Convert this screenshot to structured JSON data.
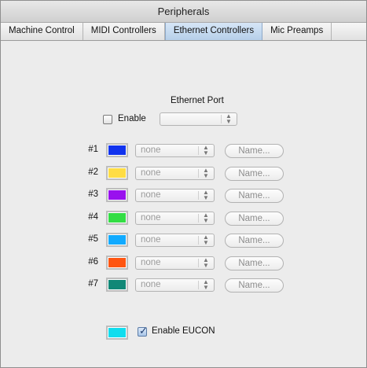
{
  "window": {
    "title": "Peripherals"
  },
  "tabs": [
    {
      "label": "Machine Control",
      "active": false
    },
    {
      "label": "MIDI Controllers",
      "active": false
    },
    {
      "label": "Ethernet Controllers",
      "active": true
    },
    {
      "label": "Mic Preamps",
      "active": false
    }
  ],
  "ethernet": {
    "section_label": "Ethernet Port",
    "enable_label": "Enable",
    "enable_checked": false,
    "port_value": ""
  },
  "controllers": [
    {
      "number": "#1",
      "color": "#1133ee",
      "select_value": "none",
      "name_button": "Name..."
    },
    {
      "number": "#2",
      "color": "#ffdd44",
      "select_value": "none",
      "name_button": "Name..."
    },
    {
      "number": "#3",
      "color": "#9911ee",
      "select_value": "none",
      "name_button": "Name..."
    },
    {
      "number": "#4",
      "color": "#33dd44",
      "select_value": "none",
      "name_button": "Name..."
    },
    {
      "number": "#5",
      "color": "#11aaff",
      "select_value": "none",
      "name_button": "Name..."
    },
    {
      "number": "#6",
      "color": "#ff5511",
      "select_value": "none",
      "name_button": "Name..."
    },
    {
      "number": "#7",
      "color": "#118877",
      "select_value": "none",
      "name_button": "Name..."
    }
  ],
  "eucon": {
    "color": "#11ddee",
    "label": "Enable EUCON",
    "checked": true
  },
  "icons": {
    "select_arrows": "updown-arrows-icon",
    "check": "checkmark-icon"
  }
}
